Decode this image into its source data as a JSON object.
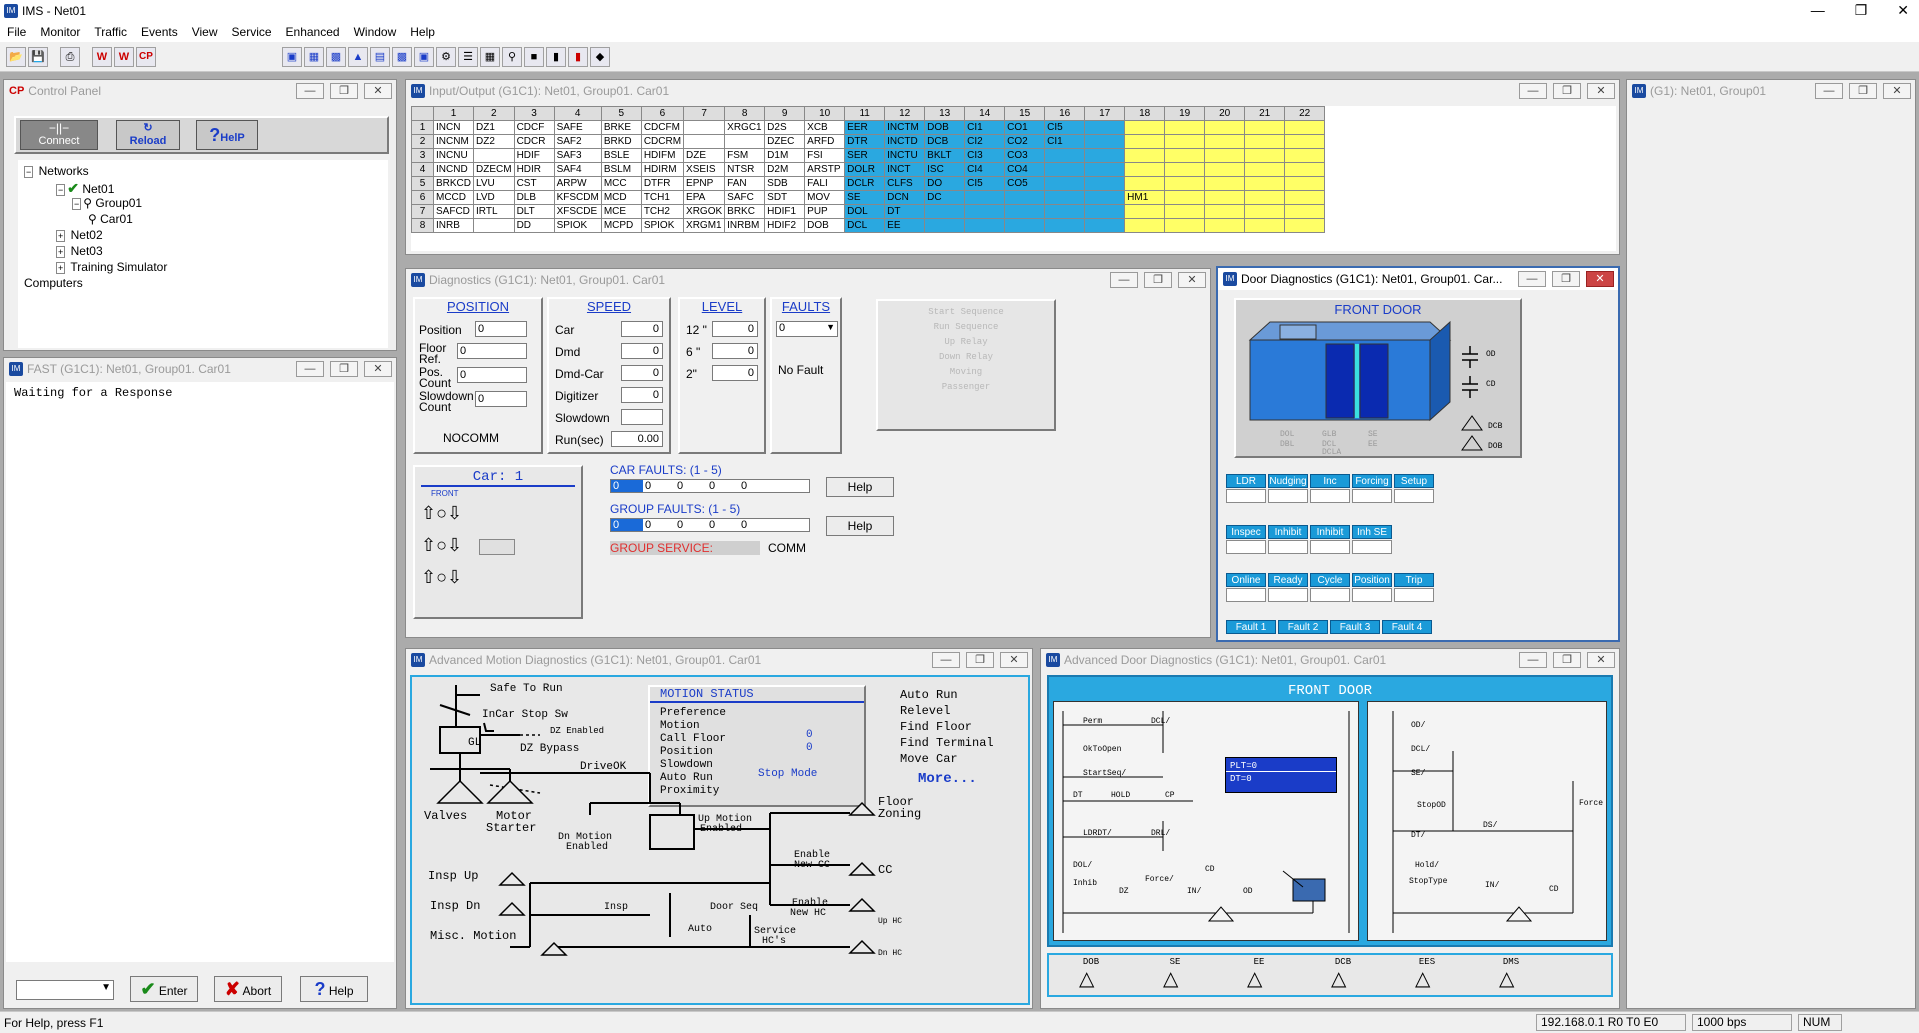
{
  "app": {
    "title": "IMS - Net01",
    "icon": "ims-app-icon"
  },
  "menu": [
    "File",
    "Monitor",
    "Traffic",
    "Events",
    "View",
    "Service",
    "Enhanced",
    "Window",
    "Help"
  ],
  "toolbar": {
    "icons": [
      "open-icon",
      "save-icon",
      "print-icon",
      "wk-icon",
      "ws-icon",
      "cp-icon",
      "window1-icon",
      "grid-icon",
      "table-icon",
      "triangle-icon",
      "doc-icon",
      "screen-icon",
      "chart-icon",
      "settings-icon",
      "list-icon",
      "keypad-icon",
      "search-icon",
      "lock-icon",
      "book-icon",
      "map-icon",
      "car-icon"
    ]
  },
  "control_panel": {
    "title": "Control Panel",
    "title_badge": "CP",
    "connect": "Connect",
    "reload": "Reload",
    "help": "HelP",
    "tree": [
      {
        "label": "Networks",
        "level": 0
      },
      {
        "label": "Net01",
        "level": 1
      },
      {
        "label": "Group01",
        "level": 2
      },
      {
        "label": "Car01",
        "level": 3
      },
      {
        "label": "Net02",
        "level": 1
      },
      {
        "label": "Net03",
        "level": 1
      },
      {
        "label": "Training Simulator",
        "level": 1
      },
      {
        "label": "Computers",
        "level": 0
      }
    ]
  },
  "fast": {
    "title": "FAST (G1C1): Net01, Group01. Car01",
    "message": "Waiting for a Response",
    "enter": "Enter",
    "abort": "Abort",
    "help": "Help"
  },
  "io": {
    "title": "Input/Output (G1C1): Net01, Group01. Car01",
    "columns": [
      "1",
      "2",
      "3",
      "4",
      "5",
      "6",
      "7",
      "8",
      "9",
      "10",
      "11",
      "12",
      "13",
      "14",
      "15",
      "16",
      "17",
      "18",
      "19",
      "20",
      "21",
      "22"
    ],
    "rows": [
      [
        "INCN",
        "DZ1",
        "CDCF",
        "SAFE",
        "BRKE",
        "CDCFM",
        "",
        "XRGC1",
        "D2S",
        "XCB",
        "EER",
        "INCTM",
        "DOB",
        "CI1",
        "CO1",
        "CI5"
      ],
      [
        "INCNM",
        "DZ2",
        "CDCR",
        "SAF2",
        "BRKD",
        "CDCRM",
        "",
        "",
        "DZEC",
        "ARFD",
        "DTR",
        "INCTD",
        "DCB",
        "CI2",
        "CO2",
        "CI1"
      ],
      [
        "INCNU",
        "",
        "HDIF",
        "SAF3",
        "BSLE",
        "HDIFM",
        "DZE",
        "FSM",
        "D1M",
        "FSI",
        "SER",
        "INCTU",
        "BKLT",
        "CI3",
        "CO3",
        ""
      ],
      [
        "INCND",
        "DZECM",
        "HDIR",
        "SAF4",
        "BSLM",
        "HDIRM",
        "XSEIS",
        "NTSR",
        "D2M",
        "ARSTP",
        "DOLR",
        "INCT",
        "ISC",
        "CI4",
        "CO4",
        ""
      ],
      [
        "BRKCD",
        "LVU",
        "CST",
        "ARPW",
        "MCC",
        "DTFR",
        "EPNP",
        "FAN",
        "SDB",
        "FALI",
        "DCLR",
        "CLFS",
        "DO",
        "CI5",
        "CO5",
        ""
      ],
      [
        "MCCD",
        "LVD",
        "DLB",
        "KFSCDM",
        "MCD",
        "TCH1",
        "EPA",
        "SAFC",
        "SDT",
        "MOV",
        "SE",
        "DCN",
        "DC",
        "",
        "",
        "",
        ""
      ],
      [
        "SAFCD",
        "IRTL",
        "DLT",
        "XFSCDE",
        "MCE",
        "TCH2",
        "XRGOK",
        "BRKC",
        "HDIF1",
        "PUP",
        "DOL",
        "DT",
        "",
        "",
        "",
        ""
      ],
      [
        "INRB",
        "",
        "DD",
        "SPIOK",
        "MCPD",
        "SPIOK",
        "XRGM1",
        "INRBM",
        "HDIF2",
        "DOB",
        "DCL",
        "EE",
        "",
        "",
        "",
        ""
      ]
    ],
    "col18_row6": "HM1"
  },
  "g1": {
    "title": "(G1): Net01, Group01"
  },
  "diag": {
    "title": "Diagnostics (G1C1): Net01, Group01. Car01",
    "position": {
      "header": "POSITION",
      "labels": [
        "Position",
        "Floor Ref.",
        "Pos. Count",
        "Slowdown Count"
      ],
      "values": [
        "0",
        "0",
        "0",
        "0"
      ],
      "status": "NOCOMM"
    },
    "speed": {
      "header": "SPEED",
      "labels": [
        "Car",
        "Dmd",
        "Dmd-Car",
        "Digitizer",
        "Slowdown",
        "Run(sec)"
      ],
      "values": [
        "0",
        "0",
        "0",
        "0",
        "",
        "0.00"
      ]
    },
    "level": {
      "header": "LEVEL",
      "labels": [
        "12 \"",
        "6 \"",
        "2\""
      ],
      "values": [
        "0",
        "0",
        "0"
      ]
    },
    "faults": {
      "header": "FAULTS",
      "select": "0",
      "status": "No Fault"
    },
    "sequence": [
      "Start Sequence",
      "Run Sequence",
      "Up Relay",
      "Down Relay",
      "Moving",
      "Passenger"
    ],
    "car_label": "Car: 1",
    "front": "FRONT",
    "car_faults_label": "CAR FAULTS: (1 - 5)",
    "car_faults": [
      "0",
      "0",
      "0",
      "0",
      "0"
    ],
    "group_faults_label": "GROUP FAULTS: (1 - 5)",
    "group_faults": [
      "0",
      "0",
      "0",
      "0",
      "0"
    ],
    "group_service": "GROUP SERVICE:",
    "comm": "COMM",
    "help": "Help"
  },
  "door": {
    "title": "Door Diagnostics (G1C1): Net01, Group01. Car...",
    "header": "FRONT DOOR",
    "contacts": [
      "OD",
      "CD",
      "DCB",
      "DOB"
    ],
    "sublabels": [
      "DOL",
      "DBL",
      "DCL",
      "DCLA",
      "GLB",
      "SE",
      "EE"
    ],
    "row1": [
      "LDR",
      "Nudging",
      "Inc Power",
      "Forcing",
      "Setup"
    ],
    "row2": [
      "Inspec",
      "Inhibit EE",
      "Inhibit SE",
      "Inh SE Ret"
    ],
    "row3": [
      "Online",
      "Ready",
      "Cycle",
      "Position",
      "Trip Speed"
    ],
    "row4": [
      "Fault 1",
      "Fault 2",
      "Fault 3",
      "Fault 4"
    ]
  },
  "motion": {
    "title": "Advanced Motion Diagnostics (G1C1): Net01, Group01. Car01",
    "status_title": "MOTION STATUS",
    "status_lines": [
      "Preference",
      "Motion",
      "Call Floor",
      "Position",
      "Slowdown",
      "Auto Run",
      "Proximity"
    ],
    "status_values": {
      "call_floor": "0",
      "position": "0",
      "auto_run": "Stop Mode"
    },
    "right_list": [
      "Auto Run",
      "Relevel",
      "Find Floor",
      "Find Terminal",
      "Move Car"
    ],
    "more": "More...",
    "labels": {
      "safe": "Safe To Run",
      "incar": "InCar Stop Sw",
      "gl": "GL",
      "dz_enabled": "DZ Enabled",
      "dz_bypass": "DZ Bypass",
      "driveok": "DriveOK",
      "valves": "Valves",
      "motor": "Motor",
      "starter": "Starter",
      "dn_motion": "Dn Motion",
      "up_motion": "Up Motion",
      "enabled": "Enabled",
      "floor": "Floor",
      "zoning": "Zoning",
      "enable_cc": "Enable",
      "new_cc": "New CC",
      "cc": "CC",
      "insp_up": "Insp Up",
      "insp_dn": "Insp Dn",
      "misc": "Misc. Motion",
      "insp": "Insp",
      "door_seq": "Door Seq",
      "auto": "Auto",
      "enable_hc": "Enable",
      "new_hc": "New HC",
      "service": "Service",
      "hcs": "HC's",
      "up_hc": "Up HC",
      "dn_hc": "Dn HC"
    }
  },
  "adoor": {
    "title": "Advanced Door Diagnostics (G1C1): Net01, Group01. Car01",
    "header": "FRONT DOOR",
    "plt": "PLT=0",
    "dt": "DT=0",
    "left_labels": [
      "Perm",
      "DCL/",
      "OkToOpen",
      "StartSeq/",
      "DT",
      "HOLD",
      "CP",
      "LDRDT/",
      "DRL/",
      "DOL/",
      "Inhib",
      "DZ",
      "Force/",
      "IN/",
      "OD",
      "CD"
    ],
    "right_labels": [
      "OD/",
      "DCL/",
      "SE/",
      "StopOD",
      "DS/",
      "DT/",
      "Hold/",
      "StopType",
      "Force",
      "IN/",
      "CD"
    ],
    "bottom": [
      "DOB",
      "SE",
      "EE",
      "DCB",
      "EES",
      "DMS"
    ]
  },
  "status": {
    "help": "For Help, press F1",
    "ip": "192.168.0.1 R0 T0 E0",
    "bps": "1000 bps",
    "num": "NUM"
  },
  "colors": {
    "accent_blue": "#2aa8e0",
    "yellow": "#ffff66",
    "navy": "#1a3cc8"
  }
}
